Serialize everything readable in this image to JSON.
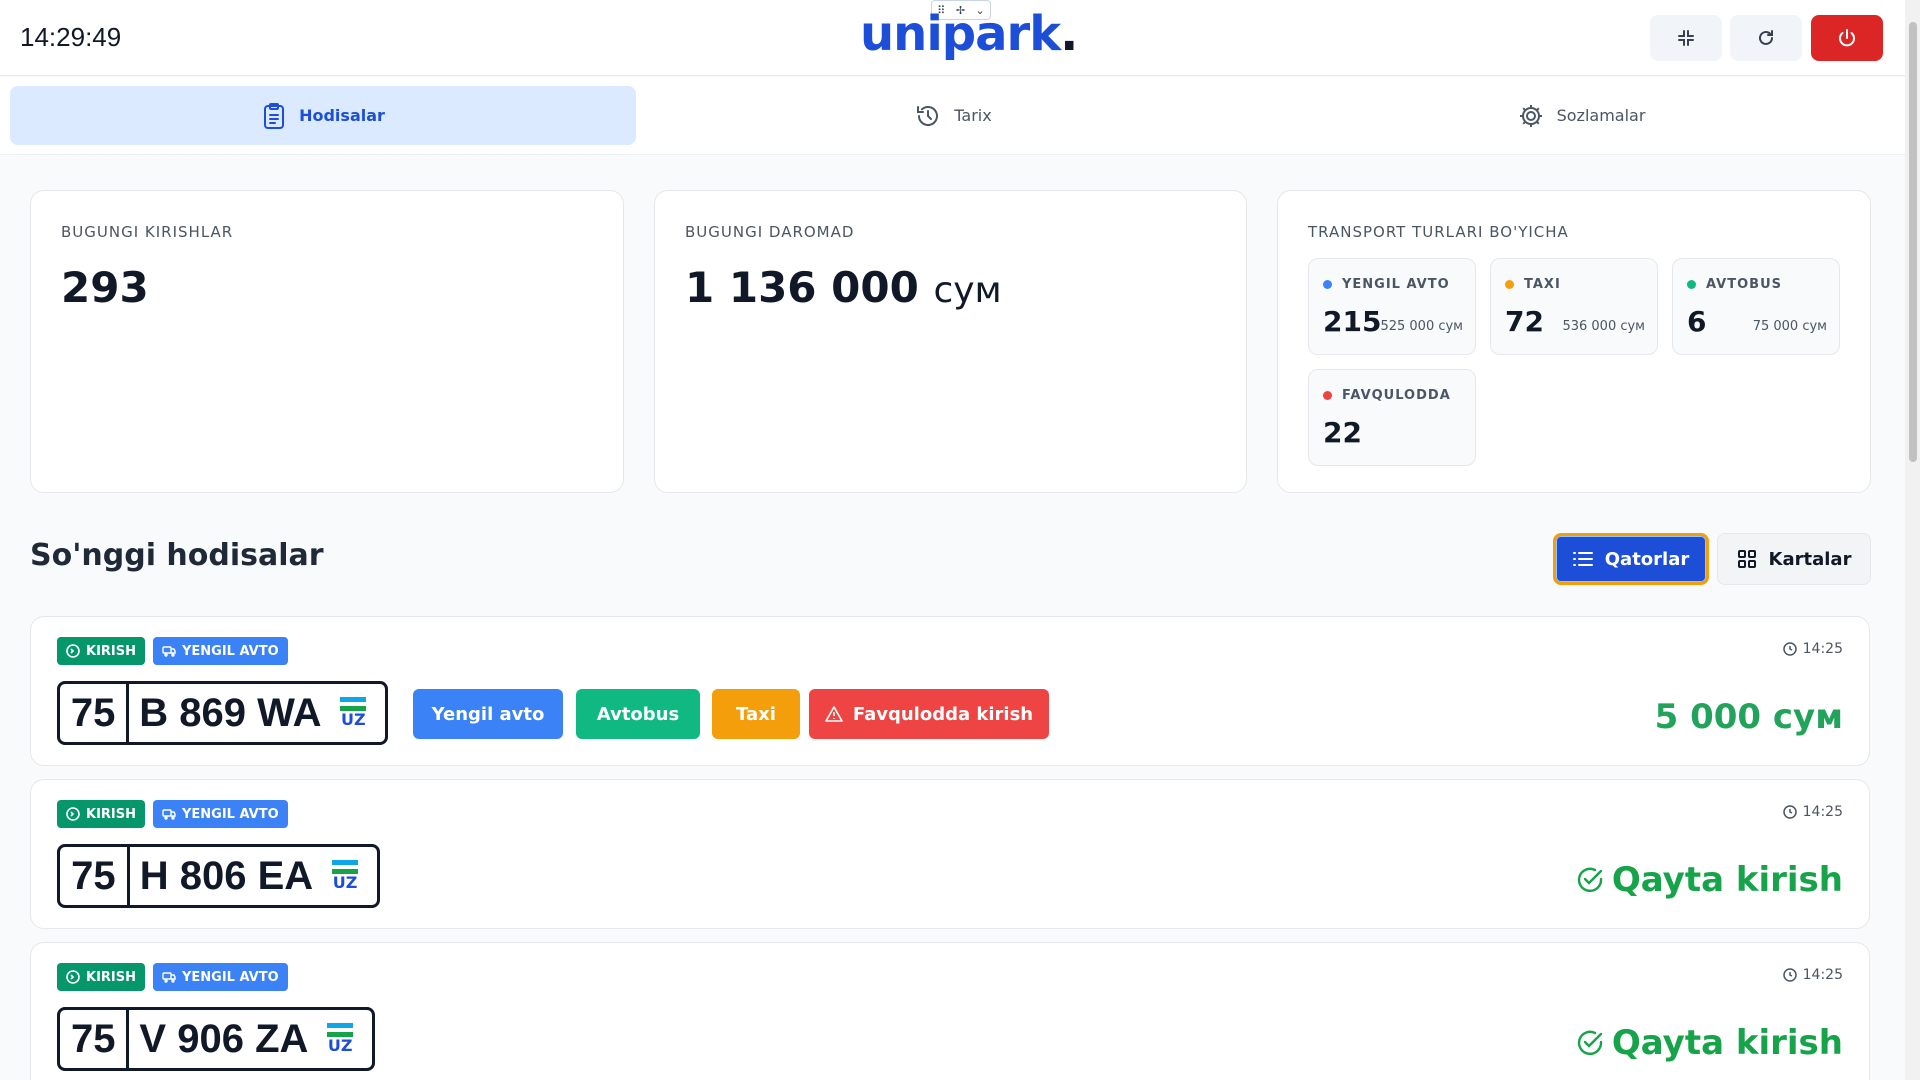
{
  "header": {
    "clock": "14:29:49",
    "logo_text": "unipark",
    "logo_dot": ".",
    "buttons": [
      "collapse-icon",
      "refresh-icon",
      "power-icon"
    ]
  },
  "tabs": [
    {
      "label": "Hodisalar",
      "icon": "clipboard-icon",
      "active": true
    },
    {
      "label": "Tarix",
      "icon": "history-icon",
      "active": false
    },
    {
      "label": "Sozlamalar",
      "icon": "gear-icon",
      "active": false
    }
  ],
  "stats": {
    "entries": {
      "label": "BUGUNGI KIRISHLAR",
      "value": "293"
    },
    "revenue": {
      "label": "BUGUNGI DAROMAD",
      "value": "1 136 000",
      "unit": "сум"
    },
    "transport": {
      "label": "TRANSPORT TURLARI BO'YICHA",
      "items": [
        {
          "label": "YENGIL AVTO",
          "count": "215",
          "amount": "525 000 сум",
          "color": "#3b82f6"
        },
        {
          "label": "TAXI",
          "count": "72",
          "amount": "536 000 сум",
          "color": "#f59e0b"
        },
        {
          "label": "AVTOBUS",
          "count": "6",
          "amount": "75 000 сум",
          "color": "#10b981"
        },
        {
          "label": "FAVQULODDA",
          "count": "22",
          "amount": "",
          "color": "#ef4444"
        }
      ]
    }
  },
  "events_section": {
    "title": "So'nggi hodisalar",
    "view_rows": "Qatorlar",
    "view_cards": "Kartalar"
  },
  "events": [
    {
      "badge_type": "KIRISH",
      "badge_vehicle": "YENGIL AVTO",
      "time": "14:25",
      "plate_region": "75",
      "plate_number": "B 869 WA",
      "plate_country": "UZ",
      "actions": {
        "yengil": "Yengil avto",
        "avtobus": "Avtobus",
        "taxi": "Taxi",
        "favqulodda": "Favqulodda kirish"
      },
      "price": "5 000 сум"
    },
    {
      "badge_type": "KIRISH",
      "badge_vehicle": "YENGIL AVTO",
      "time": "14:25",
      "plate_region": "75",
      "plate_number": "H 806 EA",
      "plate_country": "UZ",
      "status": "Qayta kirish"
    },
    {
      "badge_type": "KIRISH",
      "badge_vehicle": "YENGIL AVTO",
      "time": "14:25",
      "plate_region": "75",
      "plate_number": "V 906 ZA",
      "plate_country": "UZ",
      "status": "Qayta kirish"
    }
  ],
  "colors": {
    "brand": "#1d4ed8",
    "tab_active_bg": "#dbeafe",
    "kirish_badge": "#059669",
    "vehicle_badge": "#3b82f6",
    "success_text": "#16a34a",
    "danger": "#dc2626",
    "warning": "#f59e0b"
  }
}
